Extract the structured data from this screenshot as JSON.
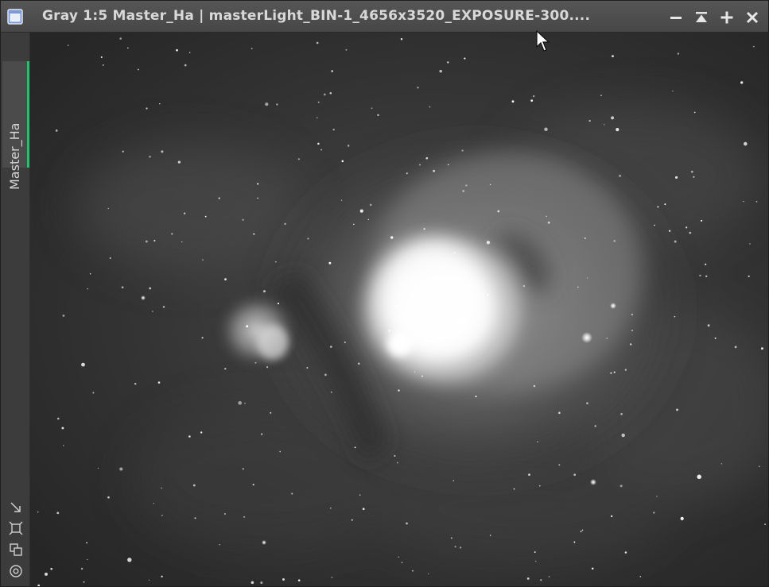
{
  "window": {
    "title": "Gray 1:5 Master_Ha | masterLight_BIN-1_4656x3520_EXPOSURE-300....",
    "icons": {
      "window": "image-window-icon",
      "minimize": "minimize-icon",
      "shade": "shade-icon",
      "maximize": "maximize-icon",
      "close": "close-icon"
    }
  },
  "sidebar": {
    "view_tab_label": "Master_Ha",
    "tab_accent_color": "#1ec46a",
    "tools": [
      {
        "icon": "resize-icon"
      },
      {
        "icon": "fit-view-icon"
      },
      {
        "icon": "clone-icon"
      },
      {
        "icon": "preview-icon"
      }
    ]
  },
  "image": {
    "subject": "astronomical image",
    "color_mode": "grayscale"
  }
}
